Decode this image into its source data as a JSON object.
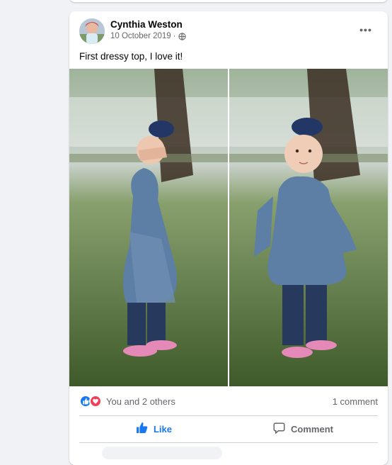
{
  "post": {
    "author": "Cynthia Weston",
    "date": "10 October 2019",
    "separator": "·",
    "privacy_icon": "globe-icon",
    "more_icon": "more-options-icon",
    "more_label": "•••",
    "text": "First dressy top, I love it!",
    "photos": [
      {
        "subject": "toddler in blue floral top with hands over face"
      },
      {
        "subject": "toddler in blue floral top smiling"
      }
    ]
  },
  "reactions": {
    "icons": [
      "like-reaction-icon",
      "love-reaction-icon"
    ],
    "summary": "You and 2 others",
    "comment_count": "1 comment"
  },
  "actions": {
    "like_label": "Like",
    "comment_label": "Comment"
  },
  "colors": {
    "accent": "#1877f2",
    "love": "#f33e58",
    "secondary_text": "#65676b",
    "background": "#f0f2f5"
  }
}
